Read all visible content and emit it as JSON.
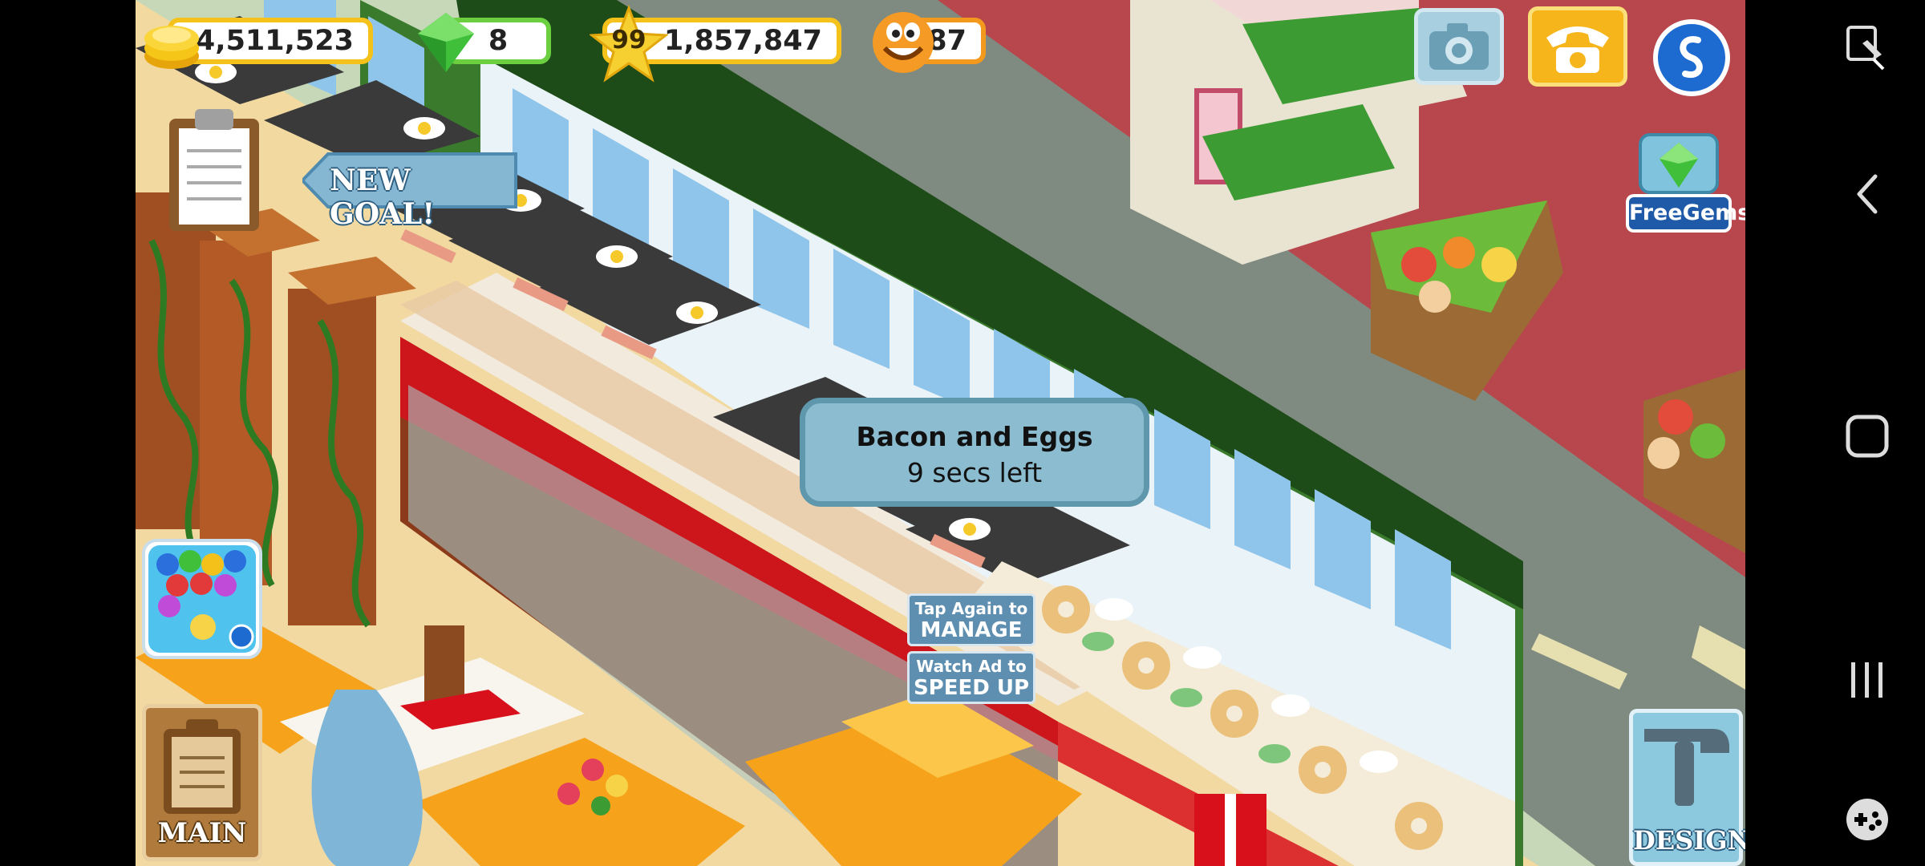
{
  "hud": {
    "coins": "14,511,523",
    "gems": "8",
    "level": "99",
    "xp": "1,857,847",
    "hearts": "87"
  },
  "new_goal": "NEW GOAL!",
  "free_gems": "FreeGems",
  "tooltip": {
    "title": "Bacon and Eggs",
    "time_left": "9 secs left"
  },
  "stove_tags": {
    "manage_line1": "Tap Again to",
    "manage_line2": "MANAGE",
    "speed_line1": "Watch Ad to",
    "speed_line2": "SPEED UP"
  },
  "main_label": "MAIN",
  "design_label": "DESIGN",
  "icons": {
    "coin": "coin-stack-icon",
    "gem": "green-gem-icon",
    "star": "star-level-icon",
    "smiley": "smiley-face-icon",
    "camera": "camera-icon",
    "phone": "telephone-icon",
    "friends": "friend-network-icon",
    "clipboard": "clipboard-icon",
    "bubble_game": "bubble-shooter-icon",
    "hammer": "hammer-icon",
    "edit": "edit-pencil-icon",
    "back": "back-icon",
    "home": "home-icon",
    "recents": "recents-icon",
    "game_tools": "gamepad-icon"
  },
  "colors": {
    "coin_border": "#f4c21a",
    "gem_border": "#6bcf3f",
    "star_border": "#f4c21a",
    "smiley_border": "#f39a1e",
    "tooltip_bg": "#8cbccf",
    "tag_bg": "#5f8fb0",
    "carpet_red": "#d8101c",
    "street_grey": "#7c8a80"
  }
}
